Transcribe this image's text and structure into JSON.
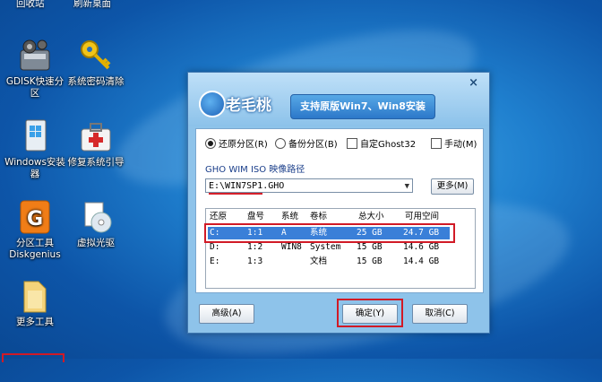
{
  "desktop": {
    "top_labels": [
      "回收站",
      "刷新桌面"
    ],
    "icons": [
      {
        "label": "GDISK快速分区",
        "icon": "gdisk-icon"
      },
      {
        "label": "系统密码清除",
        "icon": "key-icon"
      },
      {
        "label": "Windows安装器",
        "icon": "windows-installer-icon"
      },
      {
        "label": "修复系统引导",
        "icon": "repair-kit-icon"
      },
      {
        "label": "分区工具Diskgenius",
        "icon": "diskgenius-icon"
      },
      {
        "label": "虚拟光驱",
        "icon": "virtual-disc-icon"
      },
      {
        "label": "更多工具",
        "icon": "folder-icon"
      }
    ]
  },
  "dialog": {
    "close": "×",
    "logo_text": "老毛桃",
    "banner": "支持原版Win7、Win8安装",
    "options": [
      {
        "label": "还原分区(R)",
        "type": "radio",
        "checked": true
      },
      {
        "label": "备份分区(B)",
        "type": "radio",
        "checked": false
      },
      {
        "label": "自定Ghost32",
        "type": "checkbox",
        "checked": false
      },
      {
        "label": "手动(M)",
        "type": "checkbox",
        "checked": false
      }
    ],
    "path_label": "GHO WIM ISO 映像路径",
    "path_value": "E:\\WIN7SP1.GHO",
    "more_button": "更多(M)",
    "table": {
      "headers": [
        "还原",
        "盘号",
        "系统",
        "卷标",
        "总大小",
        "可用空间"
      ],
      "rows": [
        [
          "C:",
          "1:1",
          "A",
          "系统",
          "25 GB",
          "24.7 GB"
        ],
        [
          "D:",
          "1:2",
          "WIN8",
          "System",
          "15 GB",
          "14.6 GB"
        ],
        [
          "E:",
          "1:3",
          "",
          "文档",
          "15 GB",
          "14.4 GB"
        ]
      ],
      "selected_row": 0
    },
    "buttons": {
      "advanced": "高级(A)",
      "ok": "确定(Y)",
      "cancel": "取消(C)"
    }
  },
  "colors": {
    "highlight_red": "#d11a26",
    "selection_blue": "#3a7fd8"
  }
}
